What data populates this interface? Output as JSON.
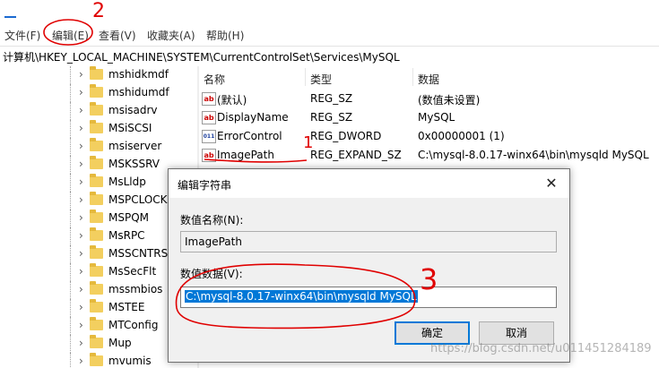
{
  "menubar": {
    "items": [
      "文件(F)",
      "编辑(E)",
      "查看(V)",
      "收藏夹(A)",
      "帮助(H)"
    ]
  },
  "address": "计算机\\HKEY_LOCAL_MACHINE\\SYSTEM\\CurrentControlSet\\Services\\MySQL",
  "tree": {
    "items": [
      "mshidkmdf",
      "mshidumdf",
      "msisadrv",
      "MSiSCSI",
      "msiserver",
      "MSKSSRV",
      "MsLldp",
      "MSPCLOCK",
      "MSPQM",
      "MsRPC",
      "MSSCNTRS",
      "MsSecFlt",
      "mssmbios",
      "MSTEE",
      "MTConfig",
      "Mup",
      "mvumis"
    ]
  },
  "list": {
    "headers": {
      "name": "名称",
      "type": "类型",
      "data": "数据"
    },
    "rows": [
      {
        "icon": "string-value-icon",
        "name": "(默认)",
        "type": "REG_SZ",
        "data": "(数值未设置)"
      },
      {
        "icon": "string-value-icon",
        "name": "DisplayName",
        "type": "REG_SZ",
        "data": "MySQL"
      },
      {
        "icon": "binary-value-icon",
        "name": "ErrorControl",
        "type": "REG_DWORD",
        "data": "0x00000001 (1)"
      },
      {
        "icon": "string-value-icon",
        "name": "ImagePath",
        "type": "REG_EXPAND_SZ",
        "data": "C:\\mysql-8.0.17-winx64\\bin\\mysqld MySQL"
      }
    ]
  },
  "dialog": {
    "title": "编辑字符串",
    "close_glyph": "✕",
    "name_label": "数值名称(N):",
    "name_value": "ImagePath",
    "data_label": "数值数据(V):",
    "data_value": "C:\\mysql-8.0.17-winx64\\bin\\mysqld MySQL",
    "ok_label": "确定",
    "cancel_label": "取消"
  },
  "annotations": {
    "mark1": "1",
    "mark2": "2",
    "mark3": "3"
  },
  "watermark": "https://blog.csdn.net/u011451284189",
  "colors": {
    "selection": "#0078d7",
    "annotation": "#e00000",
    "folder": "#f3cf5f"
  }
}
